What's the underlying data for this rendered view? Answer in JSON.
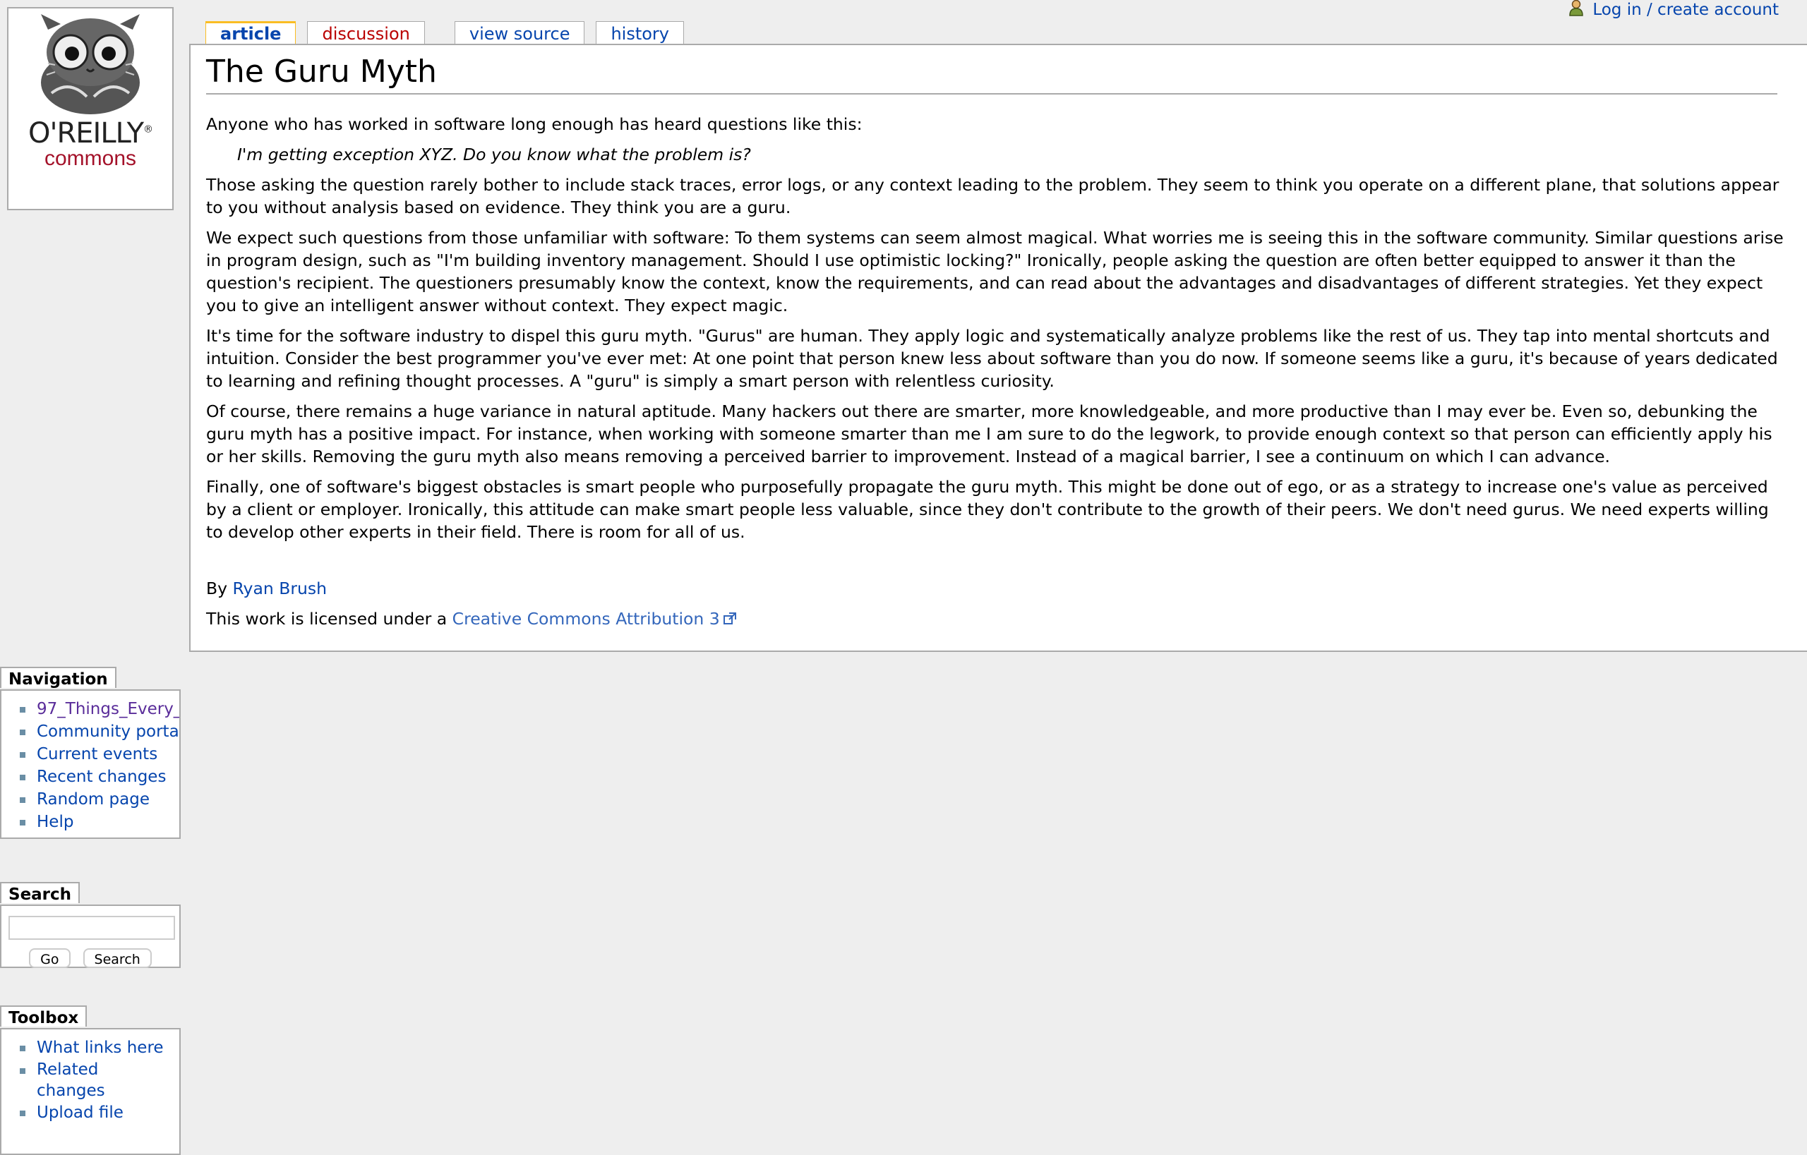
{
  "personal": {
    "login_label": "Log in / create account",
    "icon": "user-icon"
  },
  "logo": {
    "line1": "O'REILLY",
    "line2": "commons",
    "registered": "®"
  },
  "tabs": [
    {
      "label": "article",
      "state": "selected"
    },
    {
      "label": "discussion",
      "state": "new"
    },
    {
      "label": "view source",
      "state": "normal"
    },
    {
      "label": "history",
      "state": "normal"
    }
  ],
  "article": {
    "title": "The Guru Myth",
    "intro": "Anyone who has worked in software long enough has heard questions like this:",
    "quote": "I'm getting exception XYZ. Do you know what the problem is?",
    "paragraphs": [
      "Those asking the question rarely bother to include stack traces, error logs, or any context leading to the problem. They seem to think you operate on a different plane, that solutions appear to you without analysis based on evidence. They think you are a guru.",
      "We expect such questions from those unfamiliar with software: To them systems can seem almost magical. What worries me is seeing this in the software community. Similar questions arise in program design, such as \"I'm building inventory management. Should I use optimistic locking?\" Ironically, people asking the question are often better equipped to answer it than the question's recipient. The questioners presumably know the context, know the requirements, and can read about the advantages and disadvantages of different strategies. Yet they expect you to give an intelligent answer without context. They expect magic.",
      "It's time for the software industry to dispel this guru myth. \"Gurus\" are human. They apply logic and systematically analyze problems like the rest of us. They tap into mental shortcuts and intuition. Consider the best programmer you've ever met: At one point that person knew less about software than you do now. If someone seems like a guru, it's because of years dedicated to learning and refining thought processes. A \"guru\" is simply a smart person with relentless curiosity.",
      "Of course, there remains a huge variance in natural aptitude. Many hackers out there are smarter, more knowledgeable, and more productive than I may ever be. Even so, debunking the guru myth has a positive impact. For instance, when working with someone smarter than me I am sure to do the legwork, to provide enough context so that person can efficiently apply his or her skills. Removing the guru myth also means removing a perceived barrier to improvement. Instead of a magical barrier, I see a continuum on which I can advance.",
      "Finally, one of software's biggest obstacles is smart people who purposefully propagate the guru myth. This might be done out of ego, or as a strategy to increase one's value as perceived by a client or employer. Ironically, this attitude can make smart people less valuable, since they don't contribute to the growth of their peers. We don't need gurus. We need experts willing to develop other experts in their field. There is room for all of us."
    ],
    "byline_prefix": "By ",
    "author": "Ryan Brush",
    "license_prefix": "This work is licensed under a ",
    "license_link": "Creative Commons Attribution 3"
  },
  "navigation": {
    "title": "Navigation",
    "items": [
      {
        "label": "97_Things_Every_",
        "visited": true
      },
      {
        "label": "Community portal"
      },
      {
        "label": "Current events"
      },
      {
        "label": "Recent changes"
      },
      {
        "label": "Random page"
      },
      {
        "label": "Help"
      }
    ]
  },
  "search": {
    "title": "Search",
    "input_value": "",
    "go_label": "Go",
    "search_label": "Search"
  },
  "toolbox": {
    "title": "Toolbox",
    "items": [
      {
        "label": "What links here"
      },
      {
        "label": "Related changes"
      },
      {
        "label": "Upload file"
      }
    ]
  },
  "colors": {
    "link": "#0645ad",
    "new_link": "#ba0000",
    "visited": "#5a2d9a",
    "tab_selected": "#fabd23",
    "border": "#aaaaaa",
    "background": "#eeeeee"
  }
}
